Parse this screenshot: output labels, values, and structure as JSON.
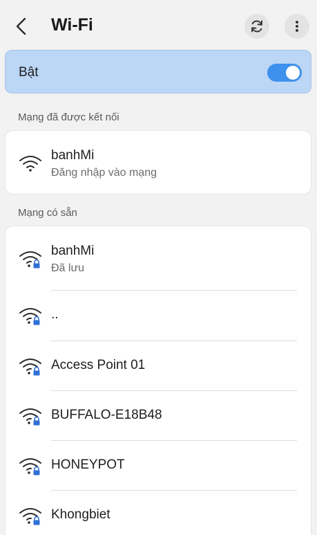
{
  "header": {
    "title": "Wi-Fi",
    "back_icon": "chevron-left-icon",
    "refresh_icon": "refresh-icon",
    "more_icon": "more-vertical-icon"
  },
  "toggle": {
    "label": "Bật",
    "state": "on",
    "accent_color": "#3e91ec"
  },
  "connected_section": {
    "label": "Mạng đã được kết nối",
    "networks": [
      {
        "name": "banhMi",
        "status": "Đăng nhập vào mạng",
        "icon": "wifi-icon",
        "locked": false
      }
    ]
  },
  "available_section": {
    "label": "Mạng có sẵn",
    "networks": [
      {
        "name": "banhMi",
        "status": "Đã lưu",
        "icon": "wifi-lock-icon",
        "locked": true
      },
      {
        "name": "..",
        "status": "",
        "icon": "wifi-lock-icon",
        "locked": true
      },
      {
        "name": "Access Point 01",
        "status": "",
        "icon": "wifi-lock-icon",
        "locked": true
      },
      {
        "name": "BUFFALO-E18B48",
        "status": "",
        "icon": "wifi-lock-icon",
        "locked": true
      },
      {
        "name": "HONEYPOT",
        "status": "",
        "icon": "wifi-lock-icon",
        "locked": true
      },
      {
        "name": "Khongbiet",
        "status": "",
        "icon": "wifi-lock-icon",
        "locked": true
      }
    ]
  }
}
